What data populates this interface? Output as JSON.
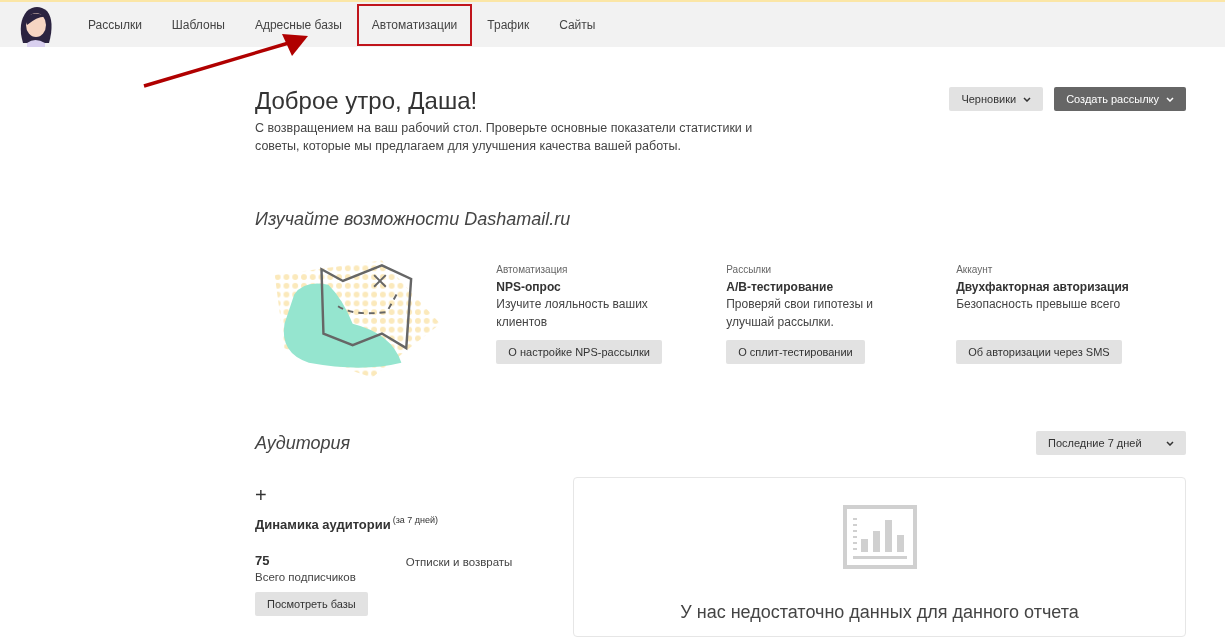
{
  "nav": {
    "items": [
      {
        "label": "Рассылки",
        "highlighted": false
      },
      {
        "label": "Шаблоны",
        "highlighted": false
      },
      {
        "label": "Адресные базы",
        "highlighted": false
      },
      {
        "label": "Автоматизации",
        "highlighted": true
      },
      {
        "label": "Трафик",
        "highlighted": false
      },
      {
        "label": "Сайты",
        "highlighted": false
      }
    ]
  },
  "greeting": {
    "title": "Доброе утро, Даша!",
    "text": "С возвращением на ваш рабочий стол. Проверьте основные показатели статистики и советы, которые мы предлагаем для улучшения качества вашей работы.",
    "buttons": [
      {
        "label": "Черновики",
        "kind": "secondary"
      },
      {
        "label": "Создать рассылку",
        "kind": "primary"
      }
    ]
  },
  "features": {
    "title": "Изучайте возможности Dashamail.ru",
    "cards": [
      {
        "category": "Автоматизация",
        "title": "NPS-опрос",
        "text": "Изучите лояльность ваших клиентов",
        "button": "О настройке NPS-рассылки"
      },
      {
        "category": "Рассылки",
        "title": "A/B-тестирование",
        "text": "Проверяй свои гипотезы и улучшай рассылки.",
        "button": "О сплит-тестировании"
      },
      {
        "category": "Аккаунт",
        "title": "Двухфакторная авторизация",
        "text": "Безопасность превыше всего",
        "button": "Об авторизации через SMS"
      }
    ]
  },
  "audience": {
    "title": "Аудитория",
    "period": "Последние 7 дней",
    "add": "+",
    "dynamics_title": "Динамика аудитории",
    "dynamics_note": "(за 7 дней)",
    "total": "75",
    "total_label": "Всего подписчиков",
    "unsubscribes_label": "Отписки и возвраты",
    "button": "Посмотреть базы",
    "empty_message": "У нас недостаточно данных для данного отчета"
  }
}
